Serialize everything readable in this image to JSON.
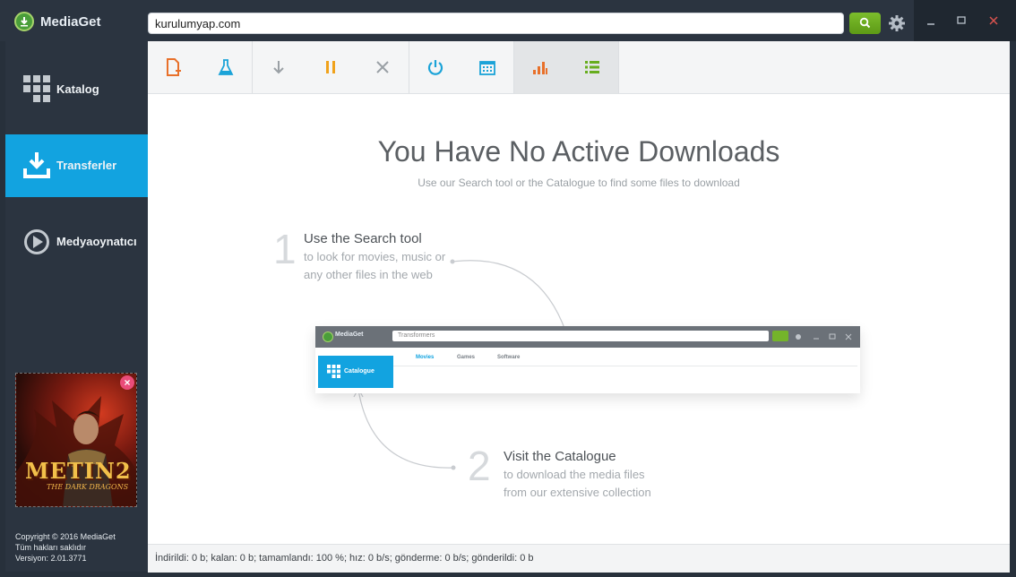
{
  "app": {
    "name": "MediaGet"
  },
  "search": {
    "value": "kurulumyap.com"
  },
  "sidebar": {
    "items": [
      {
        "label": "Katalog",
        "icon": "grid-icon"
      },
      {
        "label": "Transferler",
        "icon": "download-icon",
        "active": true
      },
      {
        "label": "Medyaoynatıcı",
        "icon": "play-icon"
      }
    ],
    "ad": {
      "title": "METIN2",
      "subtitle": "THE DARK DRAGONS"
    },
    "copyright": {
      "line1": "Copyright © 2016 MediaGet",
      "line2": "Tüm hakları saklıdır",
      "line3": "Versiyon: 2.01.3771"
    }
  },
  "toolbar": {
    "buttons": [
      {
        "icon": "add-file-icon",
        "color": "#e8702a"
      },
      {
        "icon": "flask-icon",
        "color": "#1ba3d8"
      },
      {
        "icon": "arrow-down-icon",
        "color": "#9aa0a5"
      },
      {
        "icon": "pause-icon",
        "color": "#f0a21b"
      },
      {
        "icon": "close-x-icon",
        "color": "#9aa0a5"
      },
      {
        "icon": "power-icon",
        "color": "#1ba3d8"
      },
      {
        "icon": "calendar-icon",
        "color": "#1ba3d8"
      },
      {
        "icon": "bar-chart-icon",
        "color": "#e8702a"
      },
      {
        "icon": "list-icon",
        "color": "#67ad1e"
      }
    ]
  },
  "main": {
    "title": "You Have No Active Downloads",
    "subtitle": "Use our Search tool or the Catalogue to find some files to download",
    "step1": {
      "number": "1",
      "title": "Use the Search tool",
      "line1": "to look for movies, music or",
      "line2": "any other files in the web"
    },
    "step2": {
      "number": "2",
      "title": "Visit the Catalogue",
      "line1": "to download the media files",
      "line2": "from our extensive collection"
    },
    "mini": {
      "appname": "MediaGet",
      "search_value": "Transformers",
      "catalogue": "Catalogue",
      "tabs": [
        "Movies",
        "Games",
        "Software"
      ]
    }
  },
  "status": {
    "text": "İndirildi: 0 b; kalan: 0 b; tamamlandı: 100 %; hız: 0 b/s; gönderme: 0 b/s; gönderildi: 0 b"
  },
  "colors": {
    "accent": "#12a3e0",
    "search_green": "#67ad1e",
    "sidebar_bg": "#2b3440"
  }
}
